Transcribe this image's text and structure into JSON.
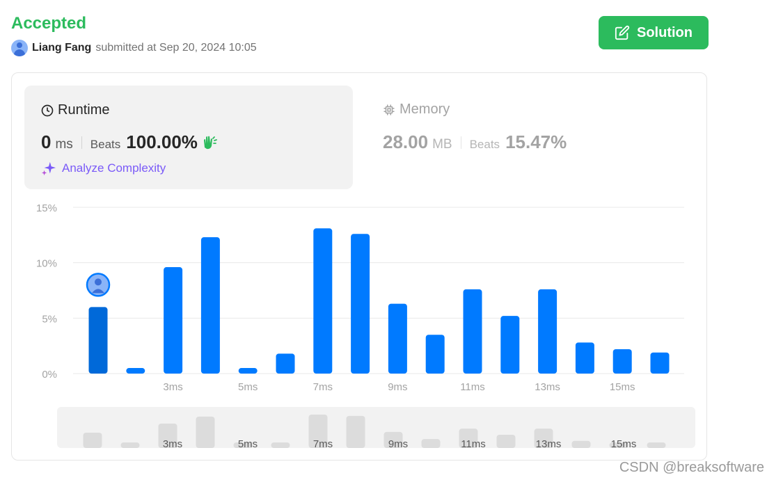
{
  "header": {
    "status": "Accepted",
    "user_name": "Liang Fang",
    "submitted_text": "submitted at Sep 20, 2024 10:05",
    "solution_button": "Solution",
    "status_color": "#2cbb5d"
  },
  "runtime": {
    "title": "Runtime",
    "value": "0",
    "unit": "ms",
    "beats_label": "Beats",
    "beats_pct": "100.00%",
    "beats_icon": "clapping-hands-icon",
    "analyze_label": "Analyze Complexity"
  },
  "memory": {
    "title": "Memory",
    "value": "28.00",
    "unit": "MB",
    "beats_label": "Beats",
    "beats_pct": "15.47%"
  },
  "chart_data": {
    "type": "bar",
    "title": "",
    "xlabel": "",
    "ylabel": "",
    "ylim": [
      0,
      15
    ],
    "y_ticks": [
      "0%",
      "5%",
      "10%",
      "15%"
    ],
    "x_tick_labels": [
      "",
      "",
      "3ms",
      "",
      "5ms",
      "",
      "7ms",
      "",
      "9ms",
      "",
      "11ms",
      "",
      "13ms",
      "",
      "15ms",
      ""
    ],
    "values": [
      6.0,
      0.5,
      9.6,
      12.3,
      0.5,
      1.8,
      13.1,
      12.6,
      6.3,
      3.5,
      7.6,
      5.2,
      7.6,
      2.8,
      2.2,
      1.9
    ],
    "highlight_index": 0,
    "bar_color": "#007aff",
    "highlight_color": "#0069d9",
    "overview_labels": [
      "",
      "",
      "3ms",
      "",
      "5ms",
      "",
      "7ms",
      "",
      "9ms",
      "",
      "11ms",
      "",
      "13ms",
      "",
      "15ms",
      ""
    ]
  },
  "watermark": "CSDN @breaksoftware"
}
